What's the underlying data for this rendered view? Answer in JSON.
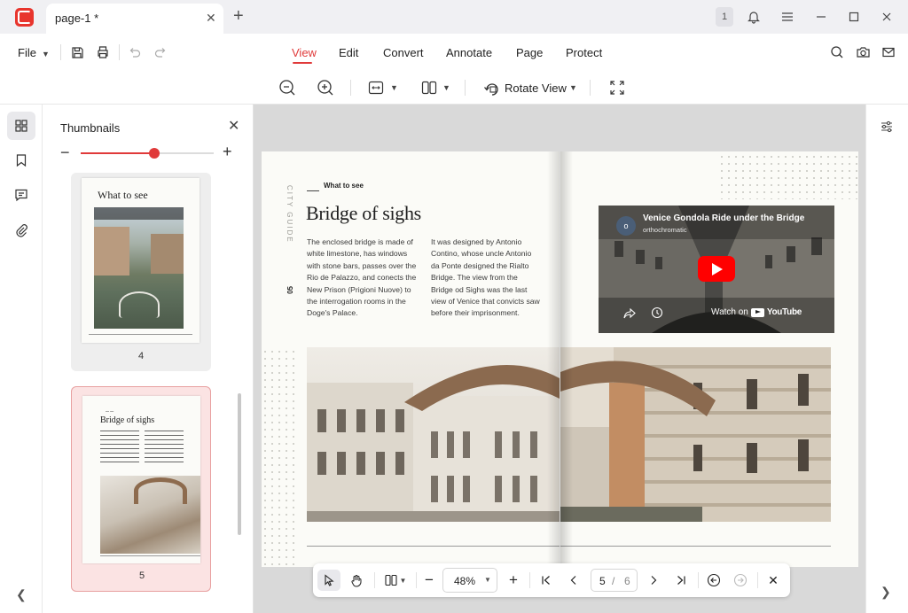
{
  "titlebar": {
    "tab_title": "page-1 *",
    "close_tab": "✕",
    "new_tab": "+",
    "notification_count": "1"
  },
  "menubar": {
    "file": "File",
    "items": [
      {
        "label": "View",
        "active": true
      },
      {
        "label": "Edit"
      },
      {
        "label": "Convert"
      },
      {
        "label": "Annotate"
      },
      {
        "label": "Page"
      },
      {
        "label": "Protect"
      }
    ]
  },
  "viewbar": {
    "rotate_view": "Rotate View"
  },
  "sidebar": {
    "title": "Thumbnails",
    "close": "✕",
    "zoom_minus": "−",
    "zoom_plus": "+",
    "zoom_level": 0.55,
    "thumbnails": [
      {
        "number": "4",
        "heading": "What to see",
        "selected": false
      },
      {
        "number": "5",
        "heading": "Bridge of sighs",
        "selected": true
      }
    ]
  },
  "document": {
    "vertical_label": "CITY GUIDE",
    "page_number": "05",
    "section_label": "What to see",
    "title": "Bridge of sighs",
    "col1": "The enclosed bridge is made of white limestone, has windows with stone bars, passes over the Rio de Palazzo, and conects the New Prison (Prigioni Nuove) to the interrogation rooms in the Doge's Palace.",
    "col2": "It was designed by Antonio Contino, whose uncle Antonio da Ponte designed the Rialto Bridge. The view from the Bridge od Sighs was the last view of Venice that convicts saw before their imprisonment.",
    "video": {
      "title": "Venice Gondola Ride under the Bridge",
      "channel": "orthochromatic",
      "avatar_letter": "o",
      "watch_on": "Watch on",
      "youtube": "YouTube"
    }
  },
  "floatbar": {
    "zoom": "48%",
    "minus": "−",
    "plus": "+",
    "current_page": "5",
    "slash": "/",
    "total_pages": "6",
    "close": "✕"
  },
  "colors": {
    "accent": "#e03a3a",
    "app_logo": "#e8352d"
  }
}
